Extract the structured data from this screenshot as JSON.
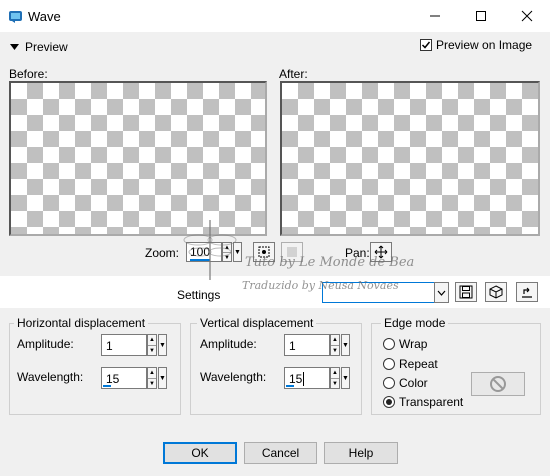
{
  "window": {
    "title": "Wave"
  },
  "preview": {
    "toggle_label": "Preview",
    "preview_on_image_label": "Preview on Image",
    "preview_on_image_checked": true
  },
  "panes": {
    "before_label": "Before:",
    "after_label": "After:"
  },
  "zoom": {
    "label": "Zoom:",
    "value": "100",
    "pan_label": "Pan:"
  },
  "settings": {
    "label": "Settings",
    "value": ""
  },
  "horizontal": {
    "title": "Horizontal displacement",
    "amplitude_label": "Amplitude:",
    "amplitude_value": "1",
    "wavelength_label": "Wavelength:",
    "wavelength_value": "15"
  },
  "vertical": {
    "title": "Vertical displacement",
    "amplitude_label": "Amplitude:",
    "amplitude_value": "1",
    "wavelength_label": "Wavelength:",
    "wavelength_value": "15"
  },
  "edge_mode": {
    "title": "Edge mode",
    "options": [
      "Wrap",
      "Repeat",
      "Color",
      "Transparent"
    ],
    "selected": "Transparent"
  },
  "buttons": {
    "ok": "OK",
    "cancel": "Cancel",
    "help": "Help"
  },
  "watermark": {
    "line1": "Tuto by Le Monde de Bea",
    "line2": "Traduzido by Neusa Novaes"
  }
}
